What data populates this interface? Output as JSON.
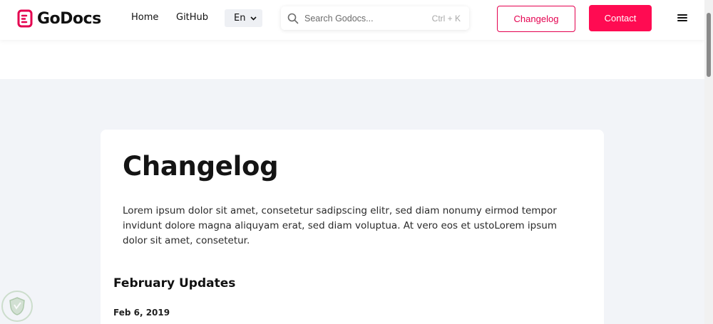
{
  "brand": {
    "name": "GoDocs",
    "accent": "#e4004f"
  },
  "nav": {
    "links": [
      {
        "label": "Home"
      },
      {
        "label": "GitHub"
      }
    ],
    "language": {
      "selected": "En"
    }
  },
  "search": {
    "placeholder": "Search Godocs...",
    "shortcut": "Ctrl + K",
    "icon": "search-icon"
  },
  "actions": {
    "changelog_label": "Changelog",
    "contact_label": "Contact",
    "menu_icon": "hamburger-menu-icon"
  },
  "page": {
    "title": "Changelog",
    "intro": "Lorem ipsum dolor sit amet, consetetur sadipscing elitr, sed diam nonumy eirmod tempor invidunt dolore magna aliquyam erat, sed diam voluptua. At vero eos et ustoLorem ipsum dolor sit amet, consetetur.",
    "sections": [
      {
        "title": "February Updates",
        "entries": [
          {
            "date": "Feb 6, 2019"
          }
        ]
      }
    ]
  },
  "colors": {
    "primary": "#ff0b52",
    "outline": "#e4004f",
    "background": "#f2f4f8",
    "card": "#ffffff"
  }
}
